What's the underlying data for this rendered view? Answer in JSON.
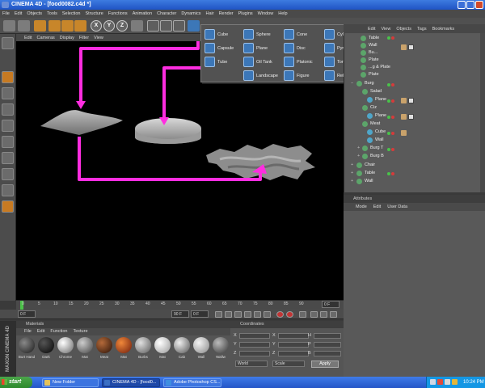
{
  "window": {
    "title": "CINEMA 4D - [food0082.c4d *]"
  },
  "menubar": {
    "items": [
      "File",
      "Edit",
      "Objects",
      "Tools",
      "Selection",
      "Structure",
      "Functions",
      "Animation",
      "Character",
      "Dynamics",
      "Hair",
      "Render",
      "Plugins",
      "Window",
      "Help"
    ]
  },
  "toolbar": {
    "axis_x": "X",
    "axis_y": "Y",
    "axis_z": "Z"
  },
  "viewport": {
    "menu": [
      "Edit",
      "Cameras",
      "Display",
      "Filter",
      "View"
    ],
    "annotation_color": "#ff2de0"
  },
  "object_popup": {
    "items": [
      {
        "label": "Cube",
        "icon": "cube-icon"
      },
      {
        "label": "Sphere",
        "icon": "sphere-icon"
      },
      {
        "label": "Cone",
        "icon": "cone-icon"
      },
      {
        "label": "Cylinder",
        "icon": "cylinder-icon"
      },
      {
        "label": "Capsule",
        "icon": "capsule-icon"
      },
      {
        "label": "Plane",
        "icon": "plane-icon"
      },
      {
        "label": "Disc",
        "icon": "disc-icon"
      },
      {
        "label": "Pyramid",
        "icon": "pyramid-icon"
      },
      {
        "label": "Tube",
        "icon": "tube-icon"
      },
      {
        "label": "Oil Tank",
        "icon": "oil-tank-icon"
      },
      {
        "label": "Platonic",
        "icon": "platonic-icon"
      },
      {
        "label": "Torus",
        "icon": "torus-icon"
      },
      {
        "label": "Landscape",
        "icon": "landscape-icon"
      },
      {
        "label": "Figure",
        "icon": "figure-icon"
      },
      {
        "label": "Relief",
        "icon": "relief-icon"
      }
    ]
  },
  "objects_manager": {
    "menu": [
      "Edit",
      "View",
      "Objects",
      "Tags",
      "Bookmarks"
    ],
    "rows": [
      {
        "label": "Table"
      },
      {
        "label": "Wall"
      },
      {
        "label": "Bu..."
      },
      {
        "label": "Plate"
      },
      {
        "label": "...g & Plate"
      },
      {
        "label": "Plate"
      },
      {
        "label": "Burg"
      },
      {
        "label": "Salad"
      },
      {
        "label": "Plane"
      },
      {
        "label": "Ciz"
      },
      {
        "label": "Plane"
      },
      {
        "label": "Meat"
      },
      {
        "label": "Cube"
      },
      {
        "label": "Wall"
      },
      {
        "label": "Burg T"
      },
      {
        "label": "Burg B"
      },
      {
        "label": "Chair"
      },
      {
        "label": "Table"
      },
      {
        "label": "Wall"
      }
    ]
  },
  "attributes": {
    "title": "Attributes",
    "menu": [
      "Mode",
      "Edit",
      "User Data"
    ]
  },
  "timeline": {
    "ticks": [
      "0",
      "5",
      "10",
      "15",
      "20",
      "25",
      "30",
      "35",
      "40",
      "45",
      "50",
      "55",
      "60",
      "65",
      "70",
      "75",
      "80",
      "85",
      "90"
    ],
    "start_frame": "0 F",
    "current_frame": "0 F",
    "end_frame": "90 F",
    "frame_readout": "0 F"
  },
  "materials": {
    "title": "Materials",
    "menu": [
      "File",
      "Edit",
      "Function",
      "Texture"
    ],
    "swatches": [
      {
        "label": "Burt Hand",
        "color": "#3a3a3a"
      },
      {
        "label": "Dark",
        "color": "#1e1e1e"
      },
      {
        "label": "Chrome",
        "color": "#b8b8b8"
      },
      {
        "label": "Mat",
        "color": "#8a8a8a"
      },
      {
        "label": "Meat",
        "color": "#6b3a1e"
      },
      {
        "label": "Mat",
        "color": "#c04b2a"
      },
      {
        "label": "Burbs",
        "color": "#9a9a9a"
      },
      {
        "label": "Mat",
        "color": "#e8e8e8"
      },
      {
        "label": "Cab",
        "color": "#a5a5a5"
      },
      {
        "label": "Wall",
        "color": "#c8c8c8"
      },
      {
        "label": "Wallw",
        "color": "#7c7c7c"
      }
    ]
  },
  "coordinates": {
    "title": "Coordinates",
    "labels": [
      "X",
      "Y",
      "Z",
      "X",
      "Y",
      "Z",
      "H",
      "P",
      "B"
    ],
    "mode_select": "World",
    "scale_select": "Scale",
    "apply_label": "Apply",
    "maxon_brand": "MAXON CINEMA 4D"
  },
  "taskbar": {
    "start_label": "start",
    "tasks": [
      {
        "label": "New Folder",
        "active": false
      },
      {
        "label": "CINEMA 4D - [food0...",
        "active": true
      },
      {
        "label": "Adobe Photoshop CS...",
        "active": false
      }
    ],
    "clock": "10:24 PM"
  }
}
